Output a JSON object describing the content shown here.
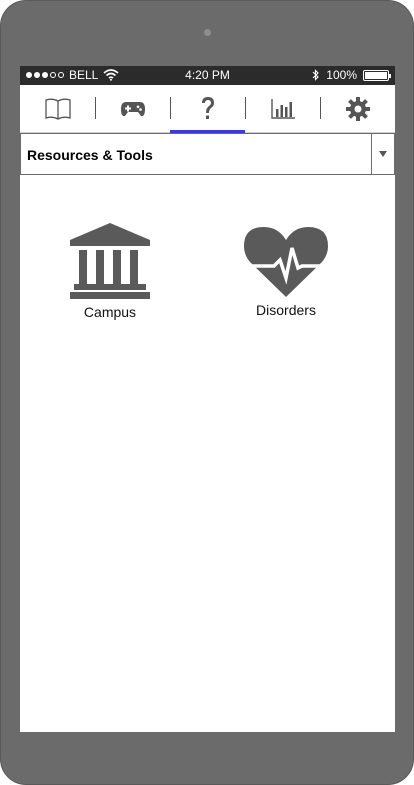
{
  "status_bar": {
    "carrier": "BELL",
    "time": "4:20 PM",
    "battery": "100%",
    "signal_filled": 3,
    "signal_total": 5
  },
  "tabs": [
    {
      "icon": "book-icon"
    },
    {
      "icon": "gamepad-icon"
    },
    {
      "icon": "question-icon",
      "active": true
    },
    {
      "icon": "bar-chart-icon"
    },
    {
      "icon": "gear-icon"
    }
  ],
  "dropdown": {
    "selected": "Resources & Tools"
  },
  "items": [
    {
      "label": "Campus",
      "icon": "building-icon"
    },
    {
      "label": "Disorders",
      "icon": "heart-pulse-icon"
    }
  ],
  "colors": {
    "device": "#6b6b6b",
    "status_bar": "#2b2b2b",
    "icon": "#5a5a5a",
    "active_tab": "#3a3ad6"
  }
}
